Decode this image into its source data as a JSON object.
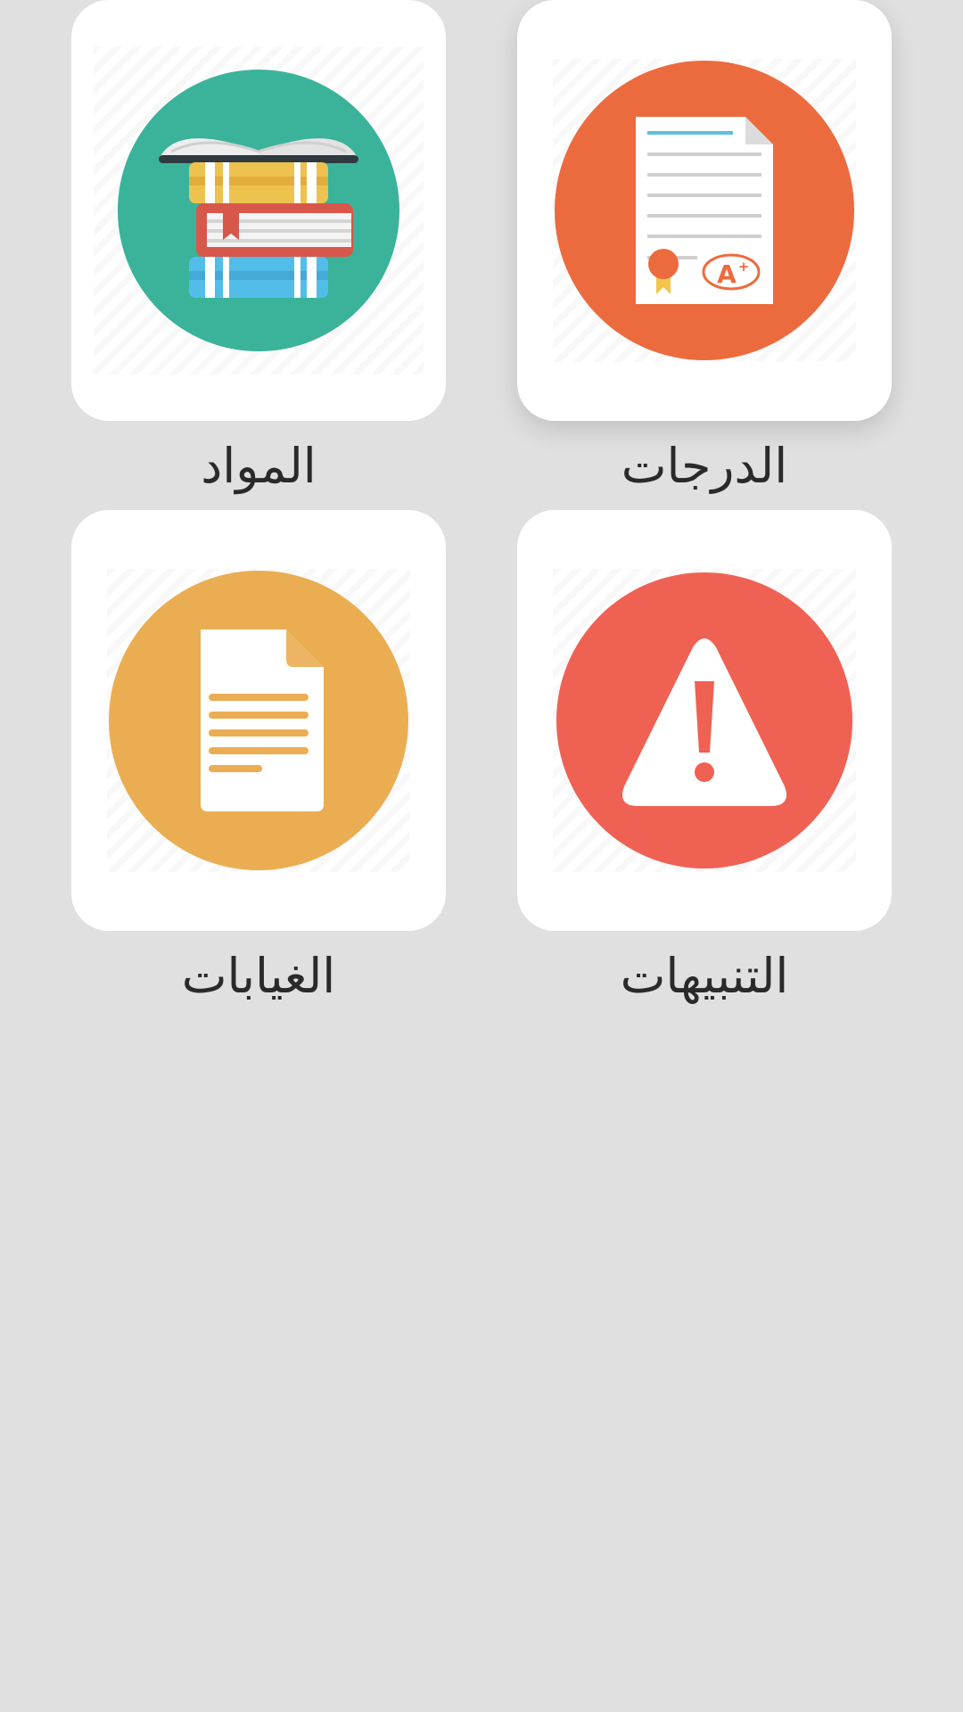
{
  "tiles": {
    "subjects": {
      "label": "المواد",
      "icon": "books-icon",
      "color": "#3ab39a"
    },
    "grades": {
      "label": "الدرجات",
      "icon": "graded-certificate-icon",
      "color": "#ec6b3e"
    },
    "absences": {
      "label": "الغيابات",
      "icon": "document-icon",
      "color": "#ebad52"
    },
    "alerts": {
      "label": "التنبيهات",
      "icon": "warning-icon",
      "color": "#ef6153"
    }
  }
}
